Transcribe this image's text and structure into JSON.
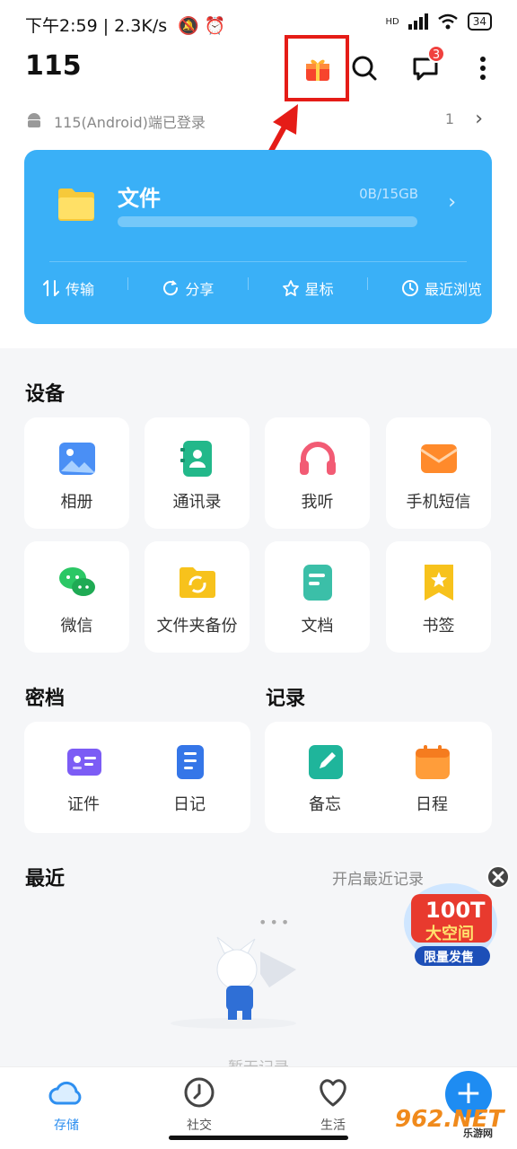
{
  "status_bar": {
    "time": "下午2:59",
    "speed": "2.3K/s",
    "network": "HD",
    "battery": "34"
  },
  "header": {
    "title": "115",
    "message_badge": "3"
  },
  "login_notice": {
    "text": "115(Android)端已登录",
    "count": "1"
  },
  "files_card": {
    "title": "文件",
    "quota": "0B/15GB",
    "usage_fraction": 0.0,
    "actions": [
      {
        "label": "传输",
        "icon": "transfer-icon"
      },
      {
        "label": "分享",
        "icon": "share-icon"
      },
      {
        "label": "星标",
        "icon": "star-icon"
      },
      {
        "label": "最近浏览",
        "icon": "clock-icon"
      }
    ]
  },
  "devices": {
    "title": "设备",
    "items": [
      {
        "label": "相册",
        "icon": "photo-album-icon"
      },
      {
        "label": "通讯录",
        "icon": "contacts-icon"
      },
      {
        "label": "我听",
        "icon": "headphones-icon"
      },
      {
        "label": "手机短信",
        "icon": "sms-icon"
      },
      {
        "label": "微信",
        "icon": "wechat-icon"
      },
      {
        "label": "文件夹备份",
        "icon": "folder-backup-icon"
      },
      {
        "label": "文档",
        "icon": "document-icon"
      },
      {
        "label": "书签",
        "icon": "bookmark-icon"
      }
    ]
  },
  "vault": {
    "title": "密档",
    "items": [
      {
        "label": "证件",
        "icon": "id-card-icon"
      },
      {
        "label": "日记",
        "icon": "diary-icon"
      }
    ]
  },
  "records": {
    "title": "记录",
    "items": [
      {
        "label": "备忘",
        "icon": "memo-icon"
      },
      {
        "label": "日程",
        "icon": "calendar-icon"
      }
    ]
  },
  "recent": {
    "title": "最近",
    "enable_link": "开启最近记录",
    "empty_text": "暂无记录"
  },
  "promo": {
    "headline": "100T",
    "subline": "大空间",
    "tag": "限量发售"
  },
  "bottom_nav": {
    "items": [
      {
        "label": "存储",
        "icon": "cloud-icon",
        "active": true
      },
      {
        "label": "社交",
        "icon": "clock-compass-icon",
        "active": false
      },
      {
        "label": "生活",
        "icon": "heart-icon",
        "active": false
      }
    ],
    "fab": "+"
  },
  "watermark": {
    "brand": "962.NET",
    "sub": "乐游网"
  },
  "colors": {
    "accent": "#3ab0f7",
    "highlight_frame": "#e51c17",
    "badge": "#f0413e",
    "nav_active": "#2e8ff0"
  }
}
